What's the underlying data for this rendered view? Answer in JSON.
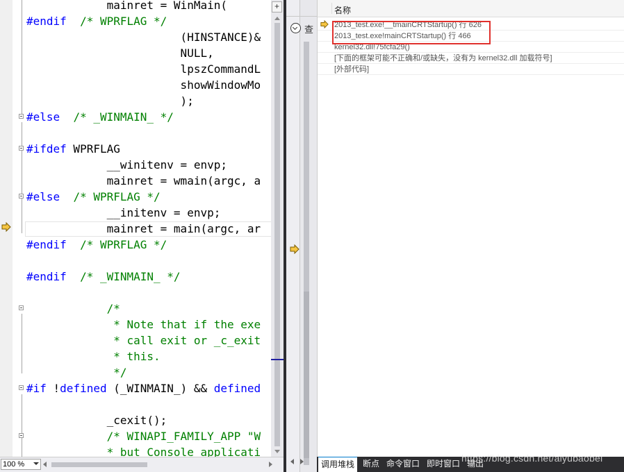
{
  "editor": {
    "zoom_level": "100 %",
    "split_button_glyph": "+",
    "code_lines": [
      {
        "id": 0,
        "parts": [
          [
            "",
            "            mainret = WinMain("
          ]
        ]
      },
      {
        "id": 1,
        "parts": [
          [
            "kw",
            "#endif"
          ],
          [
            "",
            "  "
          ],
          [
            "cm",
            "/* WPRFLAG */"
          ]
        ]
      },
      {
        "id": 2,
        "parts": [
          [
            "",
            "                       (HINSTANCE)&"
          ]
        ]
      },
      {
        "id": 3,
        "parts": [
          [
            "",
            "                       NULL,"
          ]
        ]
      },
      {
        "id": 4,
        "parts": [
          [
            "",
            "                       lpszCommandL"
          ]
        ]
      },
      {
        "id": 5,
        "parts": [
          [
            "",
            "                       showWindowMo"
          ]
        ]
      },
      {
        "id": 6,
        "parts": [
          [
            "",
            "                       );"
          ]
        ]
      },
      {
        "id": 7,
        "parts": [
          [
            "kw",
            "#else"
          ],
          [
            "",
            "  "
          ],
          [
            "cm",
            "/* _WINMAIN_ */"
          ]
        ]
      },
      {
        "id": 8,
        "parts": [
          [
            "",
            ""
          ]
        ]
      },
      {
        "id": 9,
        "parts": [
          [
            "kw",
            "#ifdef"
          ],
          [
            "",
            " WPRFLAG"
          ]
        ]
      },
      {
        "id": 10,
        "parts": [
          [
            "",
            "            __winitenv = envp;"
          ]
        ]
      },
      {
        "id": 11,
        "parts": [
          [
            "",
            "            mainret = wmain(argc, a"
          ]
        ]
      },
      {
        "id": 12,
        "parts": [
          [
            "kw",
            "#else"
          ],
          [
            "",
            "  "
          ],
          [
            "cm",
            "/* WPRFLAG */"
          ]
        ]
      },
      {
        "id": 13,
        "parts": [
          [
            "",
            "            __initenv = envp;"
          ]
        ]
      },
      {
        "id": 14,
        "parts": [
          [
            "",
            "            mainret = main(argc, ar"
          ]
        ]
      },
      {
        "id": 15,
        "parts": [
          [
            "kw",
            "#endif"
          ],
          [
            "",
            "  "
          ],
          [
            "cm",
            "/* WPRFLAG */"
          ]
        ]
      },
      {
        "id": 16,
        "parts": [
          [
            "",
            ""
          ]
        ]
      },
      {
        "id": 17,
        "parts": [
          [
            "kw",
            "#endif"
          ],
          [
            "",
            "  "
          ],
          [
            "cm",
            "/* _WINMAIN_ */"
          ]
        ]
      },
      {
        "id": 18,
        "parts": [
          [
            "",
            ""
          ]
        ]
      },
      {
        "id": 19,
        "parts": [
          [
            "",
            "            "
          ],
          [
            "cm",
            "/*"
          ]
        ]
      },
      {
        "id": 20,
        "parts": [
          [
            "",
            "             "
          ],
          [
            "cm",
            "* Note that if the exe"
          ]
        ]
      },
      {
        "id": 21,
        "parts": [
          [
            "",
            "             "
          ],
          [
            "cm",
            "* call exit or _c_exit"
          ]
        ]
      },
      {
        "id": 22,
        "parts": [
          [
            "",
            "             "
          ],
          [
            "cm",
            "* this."
          ]
        ]
      },
      {
        "id": 23,
        "parts": [
          [
            "",
            "             "
          ],
          [
            "cm",
            "*/"
          ]
        ]
      },
      {
        "id": 24,
        "parts": [
          [
            "kw",
            "#if"
          ],
          [
            "",
            " !"
          ],
          [
            "kw",
            "defined"
          ],
          [
            "",
            " (_WINMAIN_) && "
          ],
          [
            "kw",
            "defined"
          ]
        ]
      },
      {
        "id": 25,
        "parts": [
          [
            "",
            ""
          ]
        ]
      },
      {
        "id": 26,
        "parts": [
          [
            "",
            "            _cexit();"
          ]
        ]
      },
      {
        "id": 27,
        "parts": [
          [
            "",
            "            "
          ],
          [
            "cm",
            "/* WINAPI_FAMILY_APP \"W"
          ]
        ]
      },
      {
        "id": 28,
        "parts": [
          [
            "",
            "            "
          ],
          [
            "cm",
            "* but Console applicati"
          ]
        ]
      }
    ]
  },
  "mid_panel": {
    "glyph": "查"
  },
  "call_stack": {
    "column_name": "名称",
    "rows": [
      {
        "text": "2013_test.exe!__tmainCRTStartup() 行 626",
        "current": true
      },
      {
        "text": "2013_test.exe!mainCRTStartup() 行 466",
        "current": false
      },
      {
        "text": "kernel32.dll!75fcfa29()",
        "current": false
      },
      {
        "text": "[下面的框架可能不正确和/或缺失，没有为 kernel32.dll 加载符号]",
        "current": false
      },
      {
        "text": "[外部代码]",
        "current": false
      }
    ]
  },
  "tabs": [
    {
      "label": "调用堆栈",
      "active": true
    },
    {
      "label": "断点",
      "active": false
    },
    {
      "label": "命令窗口",
      "active": false
    },
    {
      "label": "即时窗口",
      "active": false
    },
    {
      "label": "输出",
      "active": false
    }
  ],
  "watermark": "https://blog.csdn.net/aiyubaobei",
  "colors": {
    "keyword": "#0000ff",
    "comment": "#008000",
    "highlight_box": "#e0302c",
    "exec_arrow": "#f5c542"
  }
}
